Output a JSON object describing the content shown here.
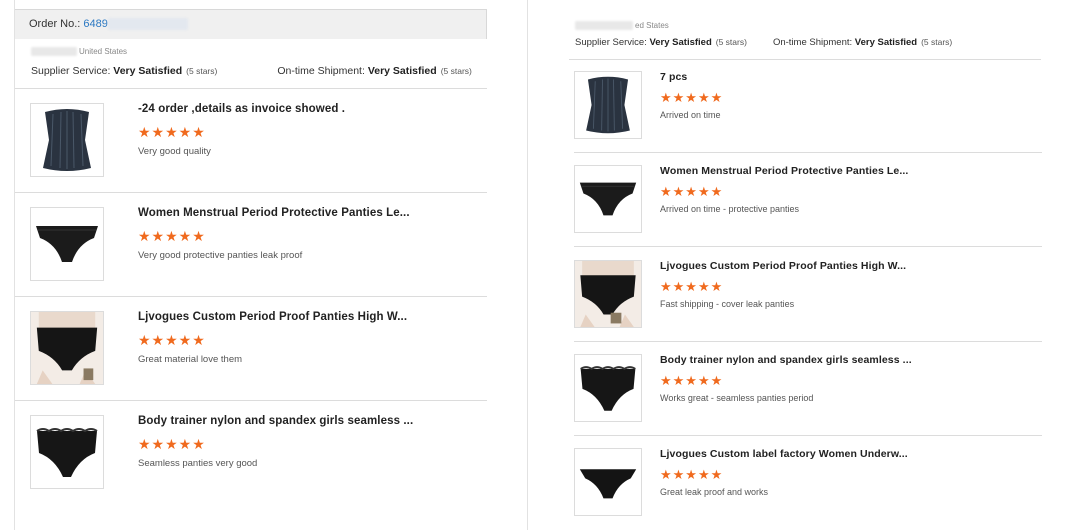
{
  "left": {
    "order_label": "Order No.:",
    "order_number": "6489",
    "location": "United States",
    "supplier_service_label": "Supplier Service:",
    "supplier_service_value": "Very Satisfied",
    "supplier_service_stars": "(5 stars)",
    "shipment_label": "On-time Shipment:",
    "shipment_value": "Very Satisfied",
    "shipment_stars": "(5 stars)",
    "items": [
      {
        "title": "-24 order ,details as invoice showed .",
        "stars": "★★★★★",
        "rating": 5,
        "comment": "Very good quality",
        "image": "corset-icon"
      },
      {
        "title": "Women Menstrual Period Protective Panties Le...",
        "stars": "★★★★★",
        "rating": 5,
        "comment": "Very good protective panties leak proof",
        "image": "brief-icon"
      },
      {
        "title": "Ljvogues Custom Period Proof Panties High W...",
        "stars": "★★★★★",
        "rating": 5,
        "comment": "Great material love them",
        "image": "highwaist-icon"
      },
      {
        "title": "Body trainer nylon and spandex girls seamless ...",
        "stars": "★★★★★",
        "rating": 5,
        "comment": "Seamless panties very good",
        "image": "lace-brief-icon"
      }
    ]
  },
  "right": {
    "location": "ed States",
    "supplier_service_label": "Supplier Service:",
    "supplier_service_value": "Very Satisfied",
    "supplier_service_stars": "(5 stars)",
    "shipment_label": "On-time Shipment:",
    "shipment_value": "Very Satisfied",
    "shipment_stars": "(5 stars)",
    "items": [
      {
        "title": "7 pcs",
        "stars": "★★★★★",
        "rating": 5,
        "comment": "Arrived on time",
        "image": "corset-icon"
      },
      {
        "title": "Women Menstrual Period Protective Panties Le...",
        "stars": "★★★★★",
        "rating": 5,
        "comment": "Arrived on time - protective panties",
        "image": "brief-icon"
      },
      {
        "title": "Ljvogues Custom Period Proof Panties High W...",
        "stars": "★★★★★",
        "rating": 5,
        "comment": "Fast shipping - cover leak panties",
        "image": "highwaist-icon"
      },
      {
        "title": "Body trainer nylon and spandex girls seamless ...",
        "stars": "★★★★★",
        "rating": 5,
        "comment": "Works great - seamless panties period",
        "image": "lace-brief-icon"
      },
      {
        "title": "Ljvogues Custom label factory Women Underw...",
        "stars": "★★★★★",
        "rating": 5,
        "comment": "Great leak proof and works",
        "image": "bikini-icon"
      }
    ]
  }
}
